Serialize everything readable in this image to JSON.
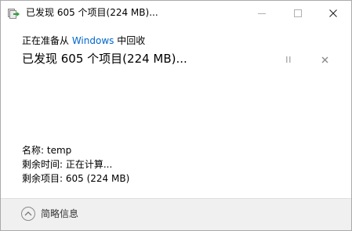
{
  "window": {
    "title": "已发现 605 个项目(224 MB)..."
  },
  "titlebar_buttons": {
    "minimize_icon": "minimize-icon",
    "maximize_icon": "maximize-icon",
    "close_icon": "close-icon"
  },
  "progress": {
    "preparing_prefix": "正在准备从 ",
    "preparing_source": "Windows",
    "preparing_suffix": " 中回收",
    "headline": "已发现 605 个项目(224 MB)...",
    "pause_icon": "pause-icon",
    "stop_icon": "close-icon"
  },
  "details": {
    "name": "名称: temp",
    "time_remaining": "剩余时间: 正在计算...",
    "items_remaining": "剩余项目: 605 (224 MB)"
  },
  "footer": {
    "less_info_label": "简略信息",
    "less_info_icon": "chevron-up-icon"
  },
  "colors": {
    "link": "#0066cc",
    "footer_bg": "#f0f0f0",
    "disabled_icon": "#b0b0b0"
  }
}
